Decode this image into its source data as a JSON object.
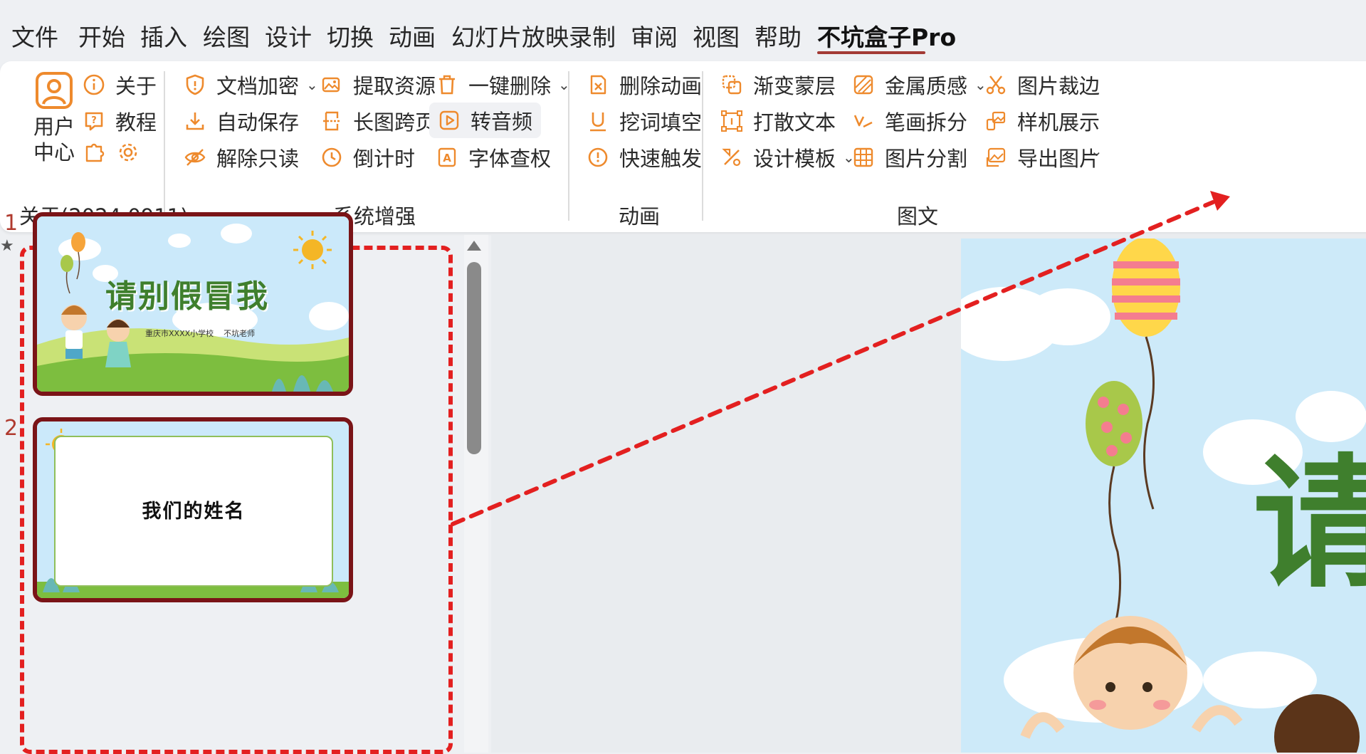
{
  "menu": {
    "tabs": [
      "文件",
      "开始",
      "插入",
      "绘图",
      "设计",
      "切换",
      "动画",
      "幻灯片放映",
      "录制",
      "审阅",
      "视图",
      "帮助",
      "不坑盒子Pro"
    ],
    "active": "不坑盒子Pro"
  },
  "ribbon": {
    "user_center": {
      "line1": "用户",
      "line2": "中心"
    },
    "about": "关于",
    "tutorial": "教程",
    "about_group_label": "关于(2024.0911)",
    "system": {
      "doc_encrypt": "文档加密",
      "auto_save": "自动保存",
      "unlock_readonly": "解除只读",
      "extract_resources": "提取资源",
      "long_image_pages": "长图跨页",
      "countdown": "倒计时",
      "one_click_delete": "一键删除",
      "to_audio": "转音频",
      "font_rights": "字体查权",
      "label": "系统增强"
    },
    "animation": {
      "delete_animation": "删除动画",
      "fill_blank": "挖词填空",
      "quick_trigger": "快速触发",
      "label": "动画"
    },
    "graphic": {
      "gradient_mask": "渐变蒙层",
      "scatter_text": "打散文本",
      "design_template": "设计模板",
      "metal_texture": "金属质感",
      "stroke_split": "笔画拆分",
      "image_split": "图片分割",
      "image_crop": "图片裁边",
      "mockup_show": "样机展示",
      "export_image": "导出图片",
      "label": "图文"
    }
  },
  "slides": [
    {
      "number": "1",
      "title": "请别假冒我",
      "subtitle": "重庆市XXXX小学校    不坑老师"
    },
    {
      "number": "2",
      "title": "我们的姓名"
    }
  ],
  "colors": {
    "accent": "#a33a35",
    "icon": "#ee8a2d",
    "dashed": "#e32020",
    "slide_border": "#7a1417"
  }
}
